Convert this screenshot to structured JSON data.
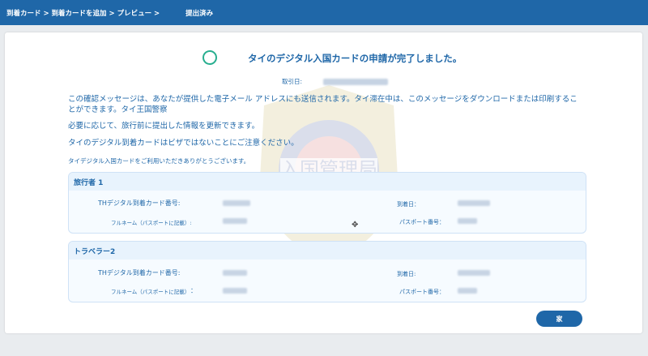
{
  "topbar": {
    "breadcrumb": "到着カード > 到着カードを追加 > プレビュー >",
    "status": "提出済み"
  },
  "confirmation": {
    "headline": "タイのデジタル入国カードの申請が完了しました。",
    "transaction_label": "取引日:",
    "transaction_value": ""
  },
  "messages": {
    "line1": "この確認メッセージは、あなたが提供した電子メール アドレスにも送信されます。タイ滞在中は、このメッセージをダウンロードまたは印刷することができます。タイ王国警察",
    "line2": "必要に応じて、旅行前に提出した情報を更新できます。",
    "line3": "タイのデジタル到着カードはビザではないことにご注意ください。",
    "line4": "タイデジタル入国カードをご利用いただきありがとうございます。"
  },
  "watermark": {
    "text": "入国管理局"
  },
  "travelers": [
    {
      "header": "旅行者 1",
      "tdac_label": "THデジタル到着カード番号:",
      "arrival_label": "到着日：",
      "name_label": "フルネーム（パスポートに記載）:",
      "passport_label": "パスポート番号："
    },
    {
      "header": "トラベラー2",
      "tdac_label": "THデジタル到着カード番号:",
      "arrival_label": "到着日:",
      "name_label": "フルネーム（パスポートに記載）",
      "name_colon": "：",
      "passport_label": "パスポート番号："
    }
  ],
  "actions": {
    "home_label": "家"
  },
  "colors": {
    "brand": "#1f67a8",
    "success": "#27ae8f"
  }
}
